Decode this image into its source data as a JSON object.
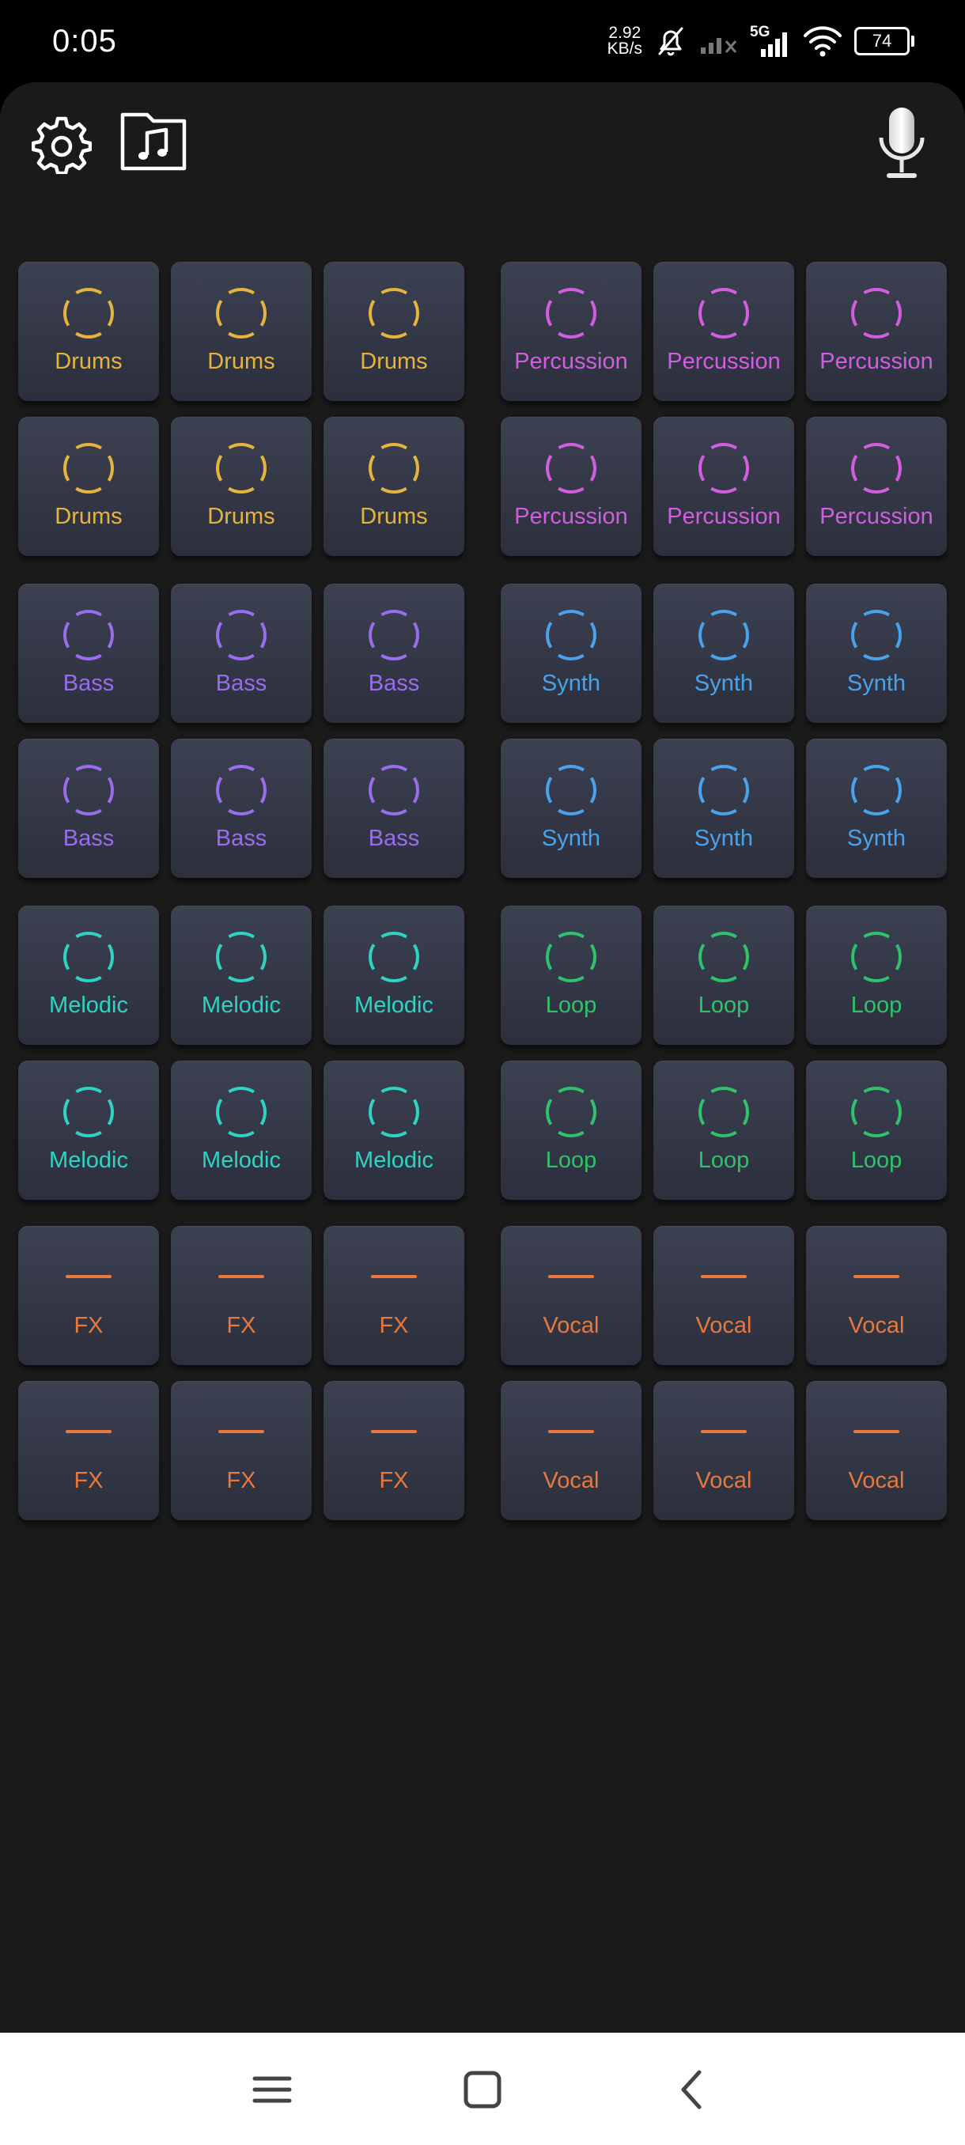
{
  "status_bar": {
    "time": "0:05",
    "net_speed_value": "2.92",
    "net_speed_unit": "KB/s",
    "network_type": "5G",
    "battery": "74",
    "icons": [
      "mute-bell-icon",
      "signal-weak-icon",
      "signal-5g-icon",
      "wifi-icon",
      "battery-icon"
    ]
  },
  "toolbar": {
    "settings_icon": "gear-icon",
    "library_icon": "music-folder-icon",
    "record_icon": "microphone-icon"
  },
  "colors": {
    "drums": "#e5b43c",
    "percussion": "#d15ee0",
    "bass": "#9a6cee",
    "synth": "#4aa3ea",
    "melodic": "#2fd3c4",
    "loop": "#2fc26a",
    "fx": "#e9783c",
    "vocal": "#e9783c"
  },
  "pads": [
    {
      "label": "Drums",
      "color": "#e5b43c",
      "icon": "ring"
    },
    {
      "label": "Drums",
      "color": "#e5b43c",
      "icon": "ring"
    },
    {
      "label": "Drums",
      "color": "#e5b43c",
      "icon": "ring"
    },
    {
      "label": "Percussion",
      "color": "#d15ee0",
      "icon": "ring"
    },
    {
      "label": "Percussion",
      "color": "#d15ee0",
      "icon": "ring"
    },
    {
      "label": "Percussion",
      "color": "#d15ee0",
      "icon": "ring"
    },
    {
      "label": "Drums",
      "color": "#e5b43c",
      "icon": "ring"
    },
    {
      "label": "Drums",
      "color": "#e5b43c",
      "icon": "ring"
    },
    {
      "label": "Drums",
      "color": "#e5b43c",
      "icon": "ring"
    },
    {
      "label": "Percussion",
      "color": "#d15ee0",
      "icon": "ring"
    },
    {
      "label": "Percussion",
      "color": "#d15ee0",
      "icon": "ring"
    },
    {
      "label": "Percussion",
      "color": "#d15ee0",
      "icon": "ring"
    },
    {
      "label": "Bass",
      "color": "#9a6cee",
      "icon": "ring"
    },
    {
      "label": "Bass",
      "color": "#9a6cee",
      "icon": "ring"
    },
    {
      "label": "Bass",
      "color": "#9a6cee",
      "icon": "ring"
    },
    {
      "label": "Synth",
      "color": "#4aa3ea",
      "icon": "ring"
    },
    {
      "label": "Synth",
      "color": "#4aa3ea",
      "icon": "ring"
    },
    {
      "label": "Synth",
      "color": "#4aa3ea",
      "icon": "ring"
    },
    {
      "label": "Bass",
      "color": "#9a6cee",
      "icon": "ring"
    },
    {
      "label": "Bass",
      "color": "#9a6cee",
      "icon": "ring"
    },
    {
      "label": "Bass",
      "color": "#9a6cee",
      "icon": "ring"
    },
    {
      "label": "Synth",
      "color": "#4aa3ea",
      "icon": "ring"
    },
    {
      "label": "Synth",
      "color": "#4aa3ea",
      "icon": "ring"
    },
    {
      "label": "Synth",
      "color": "#4aa3ea",
      "icon": "ring"
    },
    {
      "label": "Melodic",
      "color": "#2fd3c4",
      "icon": "ring"
    },
    {
      "label": "Melodic",
      "color": "#2fd3c4",
      "icon": "ring"
    },
    {
      "label": "Melodic",
      "color": "#2fd3c4",
      "icon": "ring"
    },
    {
      "label": "Loop",
      "color": "#2fc26a",
      "icon": "ring"
    },
    {
      "label": "Loop",
      "color": "#2fc26a",
      "icon": "ring"
    },
    {
      "label": "Loop",
      "color": "#2fc26a",
      "icon": "ring"
    },
    {
      "label": "Melodic",
      "color": "#2fd3c4",
      "icon": "ring"
    },
    {
      "label": "Melodic",
      "color": "#2fd3c4",
      "icon": "ring"
    },
    {
      "label": "Melodic",
      "color": "#2fd3c4",
      "icon": "ring"
    },
    {
      "label": "Loop",
      "color": "#2fc26a",
      "icon": "ring"
    },
    {
      "label": "Loop",
      "color": "#2fc26a",
      "icon": "ring"
    },
    {
      "label": "Loop",
      "color": "#2fc26a",
      "icon": "ring"
    },
    {
      "label": "FX",
      "color": "#e9783c",
      "icon": "line"
    },
    {
      "label": "FX",
      "color": "#e9783c",
      "icon": "line"
    },
    {
      "label": "FX",
      "color": "#e9783c",
      "icon": "line"
    },
    {
      "label": "Vocal",
      "color": "#e9783c",
      "icon": "line"
    },
    {
      "label": "Vocal",
      "color": "#e9783c",
      "icon": "line"
    },
    {
      "label": "Vocal",
      "color": "#e9783c",
      "icon": "line"
    },
    {
      "label": "FX",
      "color": "#e9783c",
      "icon": "line"
    },
    {
      "label": "FX",
      "color": "#e9783c",
      "icon": "line"
    },
    {
      "label": "FX",
      "color": "#e9783c",
      "icon": "line"
    },
    {
      "label": "Vocal",
      "color": "#e9783c",
      "icon": "line"
    },
    {
      "label": "Vocal",
      "color": "#e9783c",
      "icon": "line"
    },
    {
      "label": "Vocal",
      "color": "#e9783c",
      "icon": "line"
    }
  ],
  "nav_bar": {
    "icons": [
      "menu-icon",
      "home-square-icon",
      "back-chevron-icon"
    ]
  }
}
